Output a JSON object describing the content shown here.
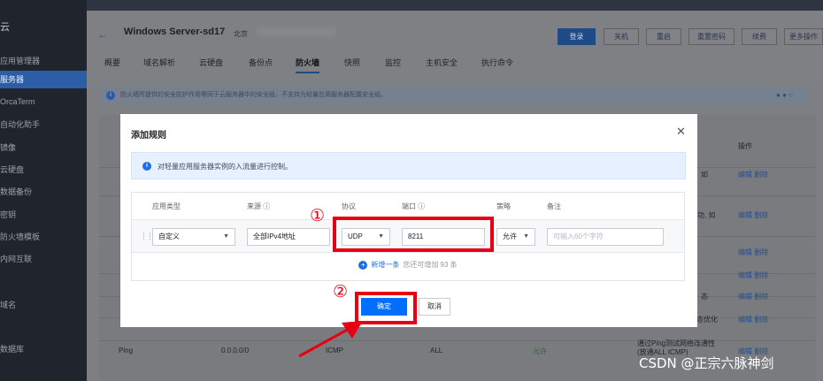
{
  "sidebar": {
    "brand": "云",
    "items": [
      "应用管理器",
      "服务器",
      "OrcaTerm",
      "自动化助手",
      "镜像",
      "云硬盘",
      "数据备份",
      "密钥",
      "防火墙模板",
      "内网互联",
      "域名",
      "数据库"
    ]
  },
  "header": {
    "back_icon": "arrow-left-icon",
    "server_title": "Windows Server-sd17",
    "region": "北京",
    "buttons": [
      "登录",
      "关机",
      "重启",
      "重置密码",
      "续费",
      "更多操作"
    ]
  },
  "tabs": [
    "概要",
    "域名解析",
    "云硬盘",
    "备份点",
    "防火墙",
    "快照",
    "监控",
    "主机安全",
    "执行命令"
  ],
  "active_tab": "防火墙",
  "banner": {
    "text": "防火墙所提供的安全防护作用等同于云服务器中的安全组，不支持为轻量应用服务器配置安全组。"
  },
  "background_rows": [
    {
      "note": "如",
      "ops": "编辑 删除"
    },
    {
      "note": "功, 如",
      "ops": "编辑 删除"
    },
    {
      "note": "",
      "ops": "编辑 删除"
    },
    {
      "note": "",
      "ops": "编辑 删除"
    },
    {
      "note": "态",
      "ops": "编辑 删除"
    },
    {
      "note": "态优化",
      "ops": "编辑 删除"
    }
  ],
  "bg_header_ops": "操作",
  "bg_bottom_row": {
    "app": "Ping",
    "source": "0.0.0.0/0",
    "protocol": "ICMP",
    "port": "ALL",
    "policy": "允许",
    "note": "通过Ping测试网络连通性 (放通ALL ICMP)",
    "ops": "编辑 删除"
  },
  "dialog": {
    "title": "添加规则",
    "close_icon": "close-icon",
    "info": "对轻量应用服务器实例的入流量进行控制。",
    "columns": {
      "app_type": "应用类型",
      "source": "来源",
      "protocol": "协议",
      "port": "端口",
      "policy": "策略",
      "note": "备注"
    },
    "row": {
      "app_type": "自定义",
      "source": "全部IPv4地址",
      "protocol": "UDP",
      "port": "8211",
      "policy": "允许",
      "note_placeholder": "可输入60个字符"
    },
    "add_link": "新增一条",
    "add_hint": "您还可增加 93 条",
    "confirm": "确定",
    "cancel": "取消"
  },
  "annotations": {
    "marker_1": "①",
    "marker_2": "②",
    "highlight_color": "#e60012"
  },
  "watermark": "CSDN @正宗六脉神剑"
}
